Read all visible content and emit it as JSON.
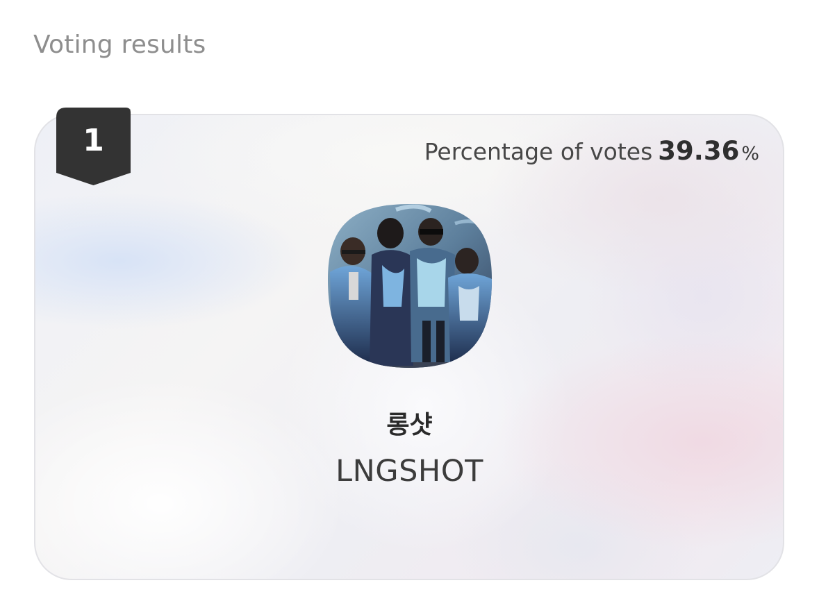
{
  "section": {
    "title": "Voting results"
  },
  "result": {
    "rank": "1",
    "percentage_label": "Percentage of votes",
    "percentage_value": "39.36",
    "percentage_unit": "%",
    "artist_name_korean": "롱샷",
    "artist_name_english": "LNGSHOT",
    "avatar_icon": "group-photo-avatar"
  },
  "colors": {
    "badge": "#333333",
    "title_text": "#8e8e8e",
    "body_text": "#3c3c3c"
  }
}
